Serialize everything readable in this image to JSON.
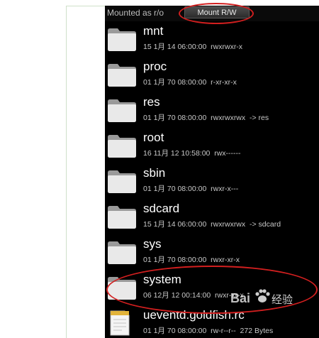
{
  "toolbar": {
    "mount_status": "Mounted as r/o",
    "mount_button_label": "Mount R/W"
  },
  "files": [
    {
      "name": "mnt",
      "meta": "15 1月 14 06:00:00  rwxrwxr-x",
      "icon": "folder-icon"
    },
    {
      "name": "proc",
      "meta": "01 1月 70 08:00:00  r-xr-xr-x",
      "icon": "folder-icon"
    },
    {
      "name": "res",
      "meta": "01 1月 70 08:00:00  rwxrwxrwx  -> res",
      "icon": "folder-icon"
    },
    {
      "name": "root",
      "meta": "16 11月 12 10:58:00  rwx------",
      "icon": "folder-icon"
    },
    {
      "name": "sbin",
      "meta": "01 1月 70 08:00:00  rwxr-x---",
      "icon": "folder-icon"
    },
    {
      "name": "sdcard",
      "meta": "15 1月 14 06:00:00  rwxrwxrwx  -> sdcard",
      "icon": "folder-icon"
    },
    {
      "name": "sys",
      "meta": "01 1月 70 08:00:00  rwxr-xr-x",
      "icon": "folder-icon"
    },
    {
      "name": "system",
      "meta": "06 12月 12 00:14:00  rwxr-xr-x",
      "icon": "folder-icon"
    },
    {
      "name": "ueventd.goldfish.rc",
      "meta": "01 1月 70 08:00:00  rw-r--r--  272 Bytes",
      "icon": "file-icon"
    }
  ],
  "watermark": {
    "brand": "Bai",
    "text": "经验"
  },
  "colors": {
    "highlight_ellipse": "#d21f1f",
    "screen_background": "#000000"
  }
}
